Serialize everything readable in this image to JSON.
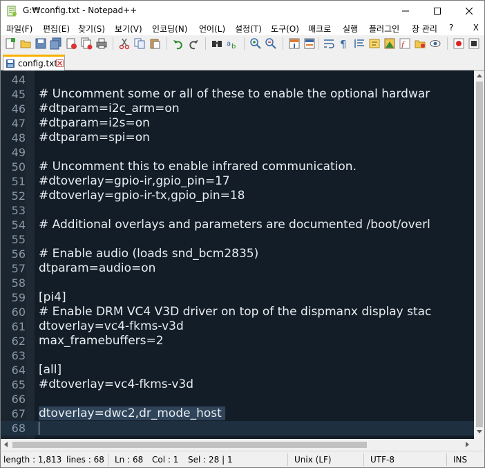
{
  "window": {
    "title": "G:₩config.txt - Notepad++",
    "minimize_icon": "minimize-icon",
    "maximize_icon": "maximize-icon",
    "close_icon": "close-icon"
  },
  "menubar": {
    "items": [
      "파일(F)",
      "편집(E)",
      "찾기(S)",
      "보기(V)",
      "인코딩(N)",
      "언어(L)",
      "설정(T)",
      "도구(O)",
      "매크로",
      "실행",
      "플러그인",
      "창 관리",
      "?"
    ],
    "close_label": "X"
  },
  "tab": {
    "label": "config.txt",
    "icon": "save-file-icon",
    "close_icon": "tab-close-icon"
  },
  "editor": {
    "theme": {
      "background": "#131d27",
      "text": "#e8edf2",
      "line_numbers": "#8a98a8",
      "current_line": "#1e2f40",
      "selection": "#2f4459"
    },
    "lines": [
      {
        "n": "44",
        "text": ""
      },
      {
        "n": "45",
        "text": "# Uncomment some or all of these to enable the optional hardwar"
      },
      {
        "n": "46",
        "text": "#dtparam=i2c_arm=on"
      },
      {
        "n": "47",
        "text": "#dtparam=i2s=on"
      },
      {
        "n": "48",
        "text": "#dtparam=spi=on"
      },
      {
        "n": "49",
        "text": ""
      },
      {
        "n": "50",
        "text": "# Uncomment this to enable infrared communication."
      },
      {
        "n": "51",
        "text": "#dtoverlay=gpio-ir,gpio_pin=17"
      },
      {
        "n": "52",
        "text": "#dtoverlay=gpio-ir-tx,gpio_pin=18"
      },
      {
        "n": "53",
        "text": ""
      },
      {
        "n": "54",
        "text": "# Additional overlays and parameters are documented /boot/overl"
      },
      {
        "n": "55",
        "text": ""
      },
      {
        "n": "56",
        "text": "# Enable audio (loads snd_bcm2835)"
      },
      {
        "n": "57",
        "text": "dtparam=audio=on"
      },
      {
        "n": "58",
        "text": ""
      },
      {
        "n": "59",
        "text": "[pi4]"
      },
      {
        "n": "60",
        "text": "# Enable DRM VC4 V3D driver on top of the dispmanx display stac"
      },
      {
        "n": "61",
        "text": "dtoverlay=vc4-fkms-v3d"
      },
      {
        "n": "62",
        "text": "max_framebuffers=2"
      },
      {
        "n": "63",
        "text": ""
      },
      {
        "n": "64",
        "text": "[all]"
      },
      {
        "n": "65",
        "text": "#dtoverlay=vc4-fkms-v3d"
      },
      {
        "n": "66",
        "text": ""
      },
      {
        "n": "67",
        "text": "dtoverlay=dwc2,dr_mode_host "
      },
      {
        "n": "68",
        "text": ""
      }
    ]
  },
  "statusbar": {
    "length": "length : 1,813",
    "lines": "lines : 68",
    "ln": "Ln : 68",
    "col": "Col : 1",
    "sel": "Sel : 28 | 1",
    "eol": "Unix (LF)",
    "encoding": "UTF-8",
    "mode": "INS"
  }
}
